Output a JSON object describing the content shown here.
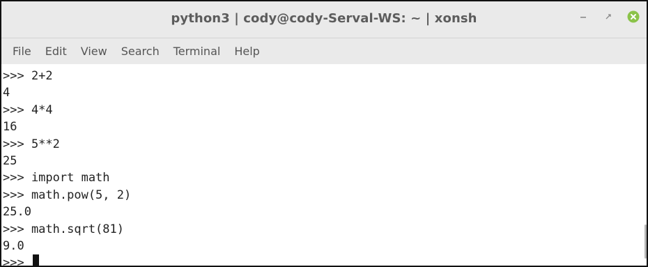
{
  "window": {
    "title": "python3 | cody@cody-Serval-WS: ~ | xonsh",
    "controls": [
      "minimize-icon",
      "maximize-icon",
      "close-icon"
    ],
    "close_color": "#8bc34a"
  },
  "menu": {
    "items": [
      {
        "label": "File"
      },
      {
        "label": "Edit"
      },
      {
        "label": "View"
      },
      {
        "label": "Search"
      },
      {
        "label": "Terminal"
      },
      {
        "label": "Help"
      }
    ]
  },
  "terminal": {
    "lines": [
      ">>> 2+2",
      "4",
      ">>> 4*4",
      "16",
      ">>> 5**2",
      "25",
      ">>> import math",
      ">>> math.pow(5, 2)",
      "25.0",
      ">>> math.sqrt(81)",
      "9.0"
    ],
    "prompt": ">>> "
  }
}
